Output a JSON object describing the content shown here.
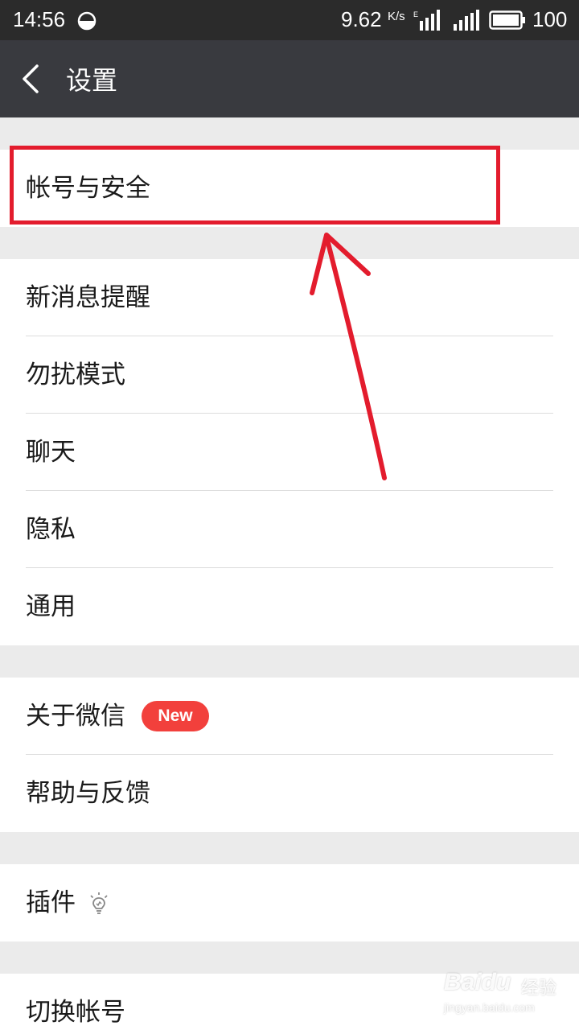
{
  "status_bar": {
    "time": "14:56",
    "net_speed": "9.62",
    "net_speed_unit": "K/s",
    "battery": "100",
    "status_circle_icon": "half-circle-icon",
    "signal_icons": [
      "signal-e-icon",
      "signal-icon"
    ],
    "battery_icon": "battery-icon"
  },
  "header": {
    "title": "设置",
    "back_icon": "chevron-left-icon"
  },
  "sections": [
    {
      "items": [
        {
          "label": "帐号与安全"
        }
      ]
    },
    {
      "items": [
        {
          "label": "新消息提醒"
        },
        {
          "label": "勿扰模式"
        },
        {
          "label": "聊天"
        },
        {
          "label": "隐私"
        },
        {
          "label": "通用"
        }
      ]
    },
    {
      "items": [
        {
          "label": "关于微信",
          "badge": "New"
        },
        {
          "label": "帮助与反馈"
        }
      ]
    },
    {
      "items": [
        {
          "label": "插件",
          "icon": "lightbulb-icon"
        }
      ]
    },
    {
      "items": [
        {
          "label": "切换帐号"
        }
      ]
    }
  ],
  "annotation": {
    "color": "#e31c2d",
    "highlight_target": "帐号与安全"
  },
  "watermark": {
    "logo": "Baidu",
    "label": "经验",
    "url": "jingyan.baidu.com"
  }
}
